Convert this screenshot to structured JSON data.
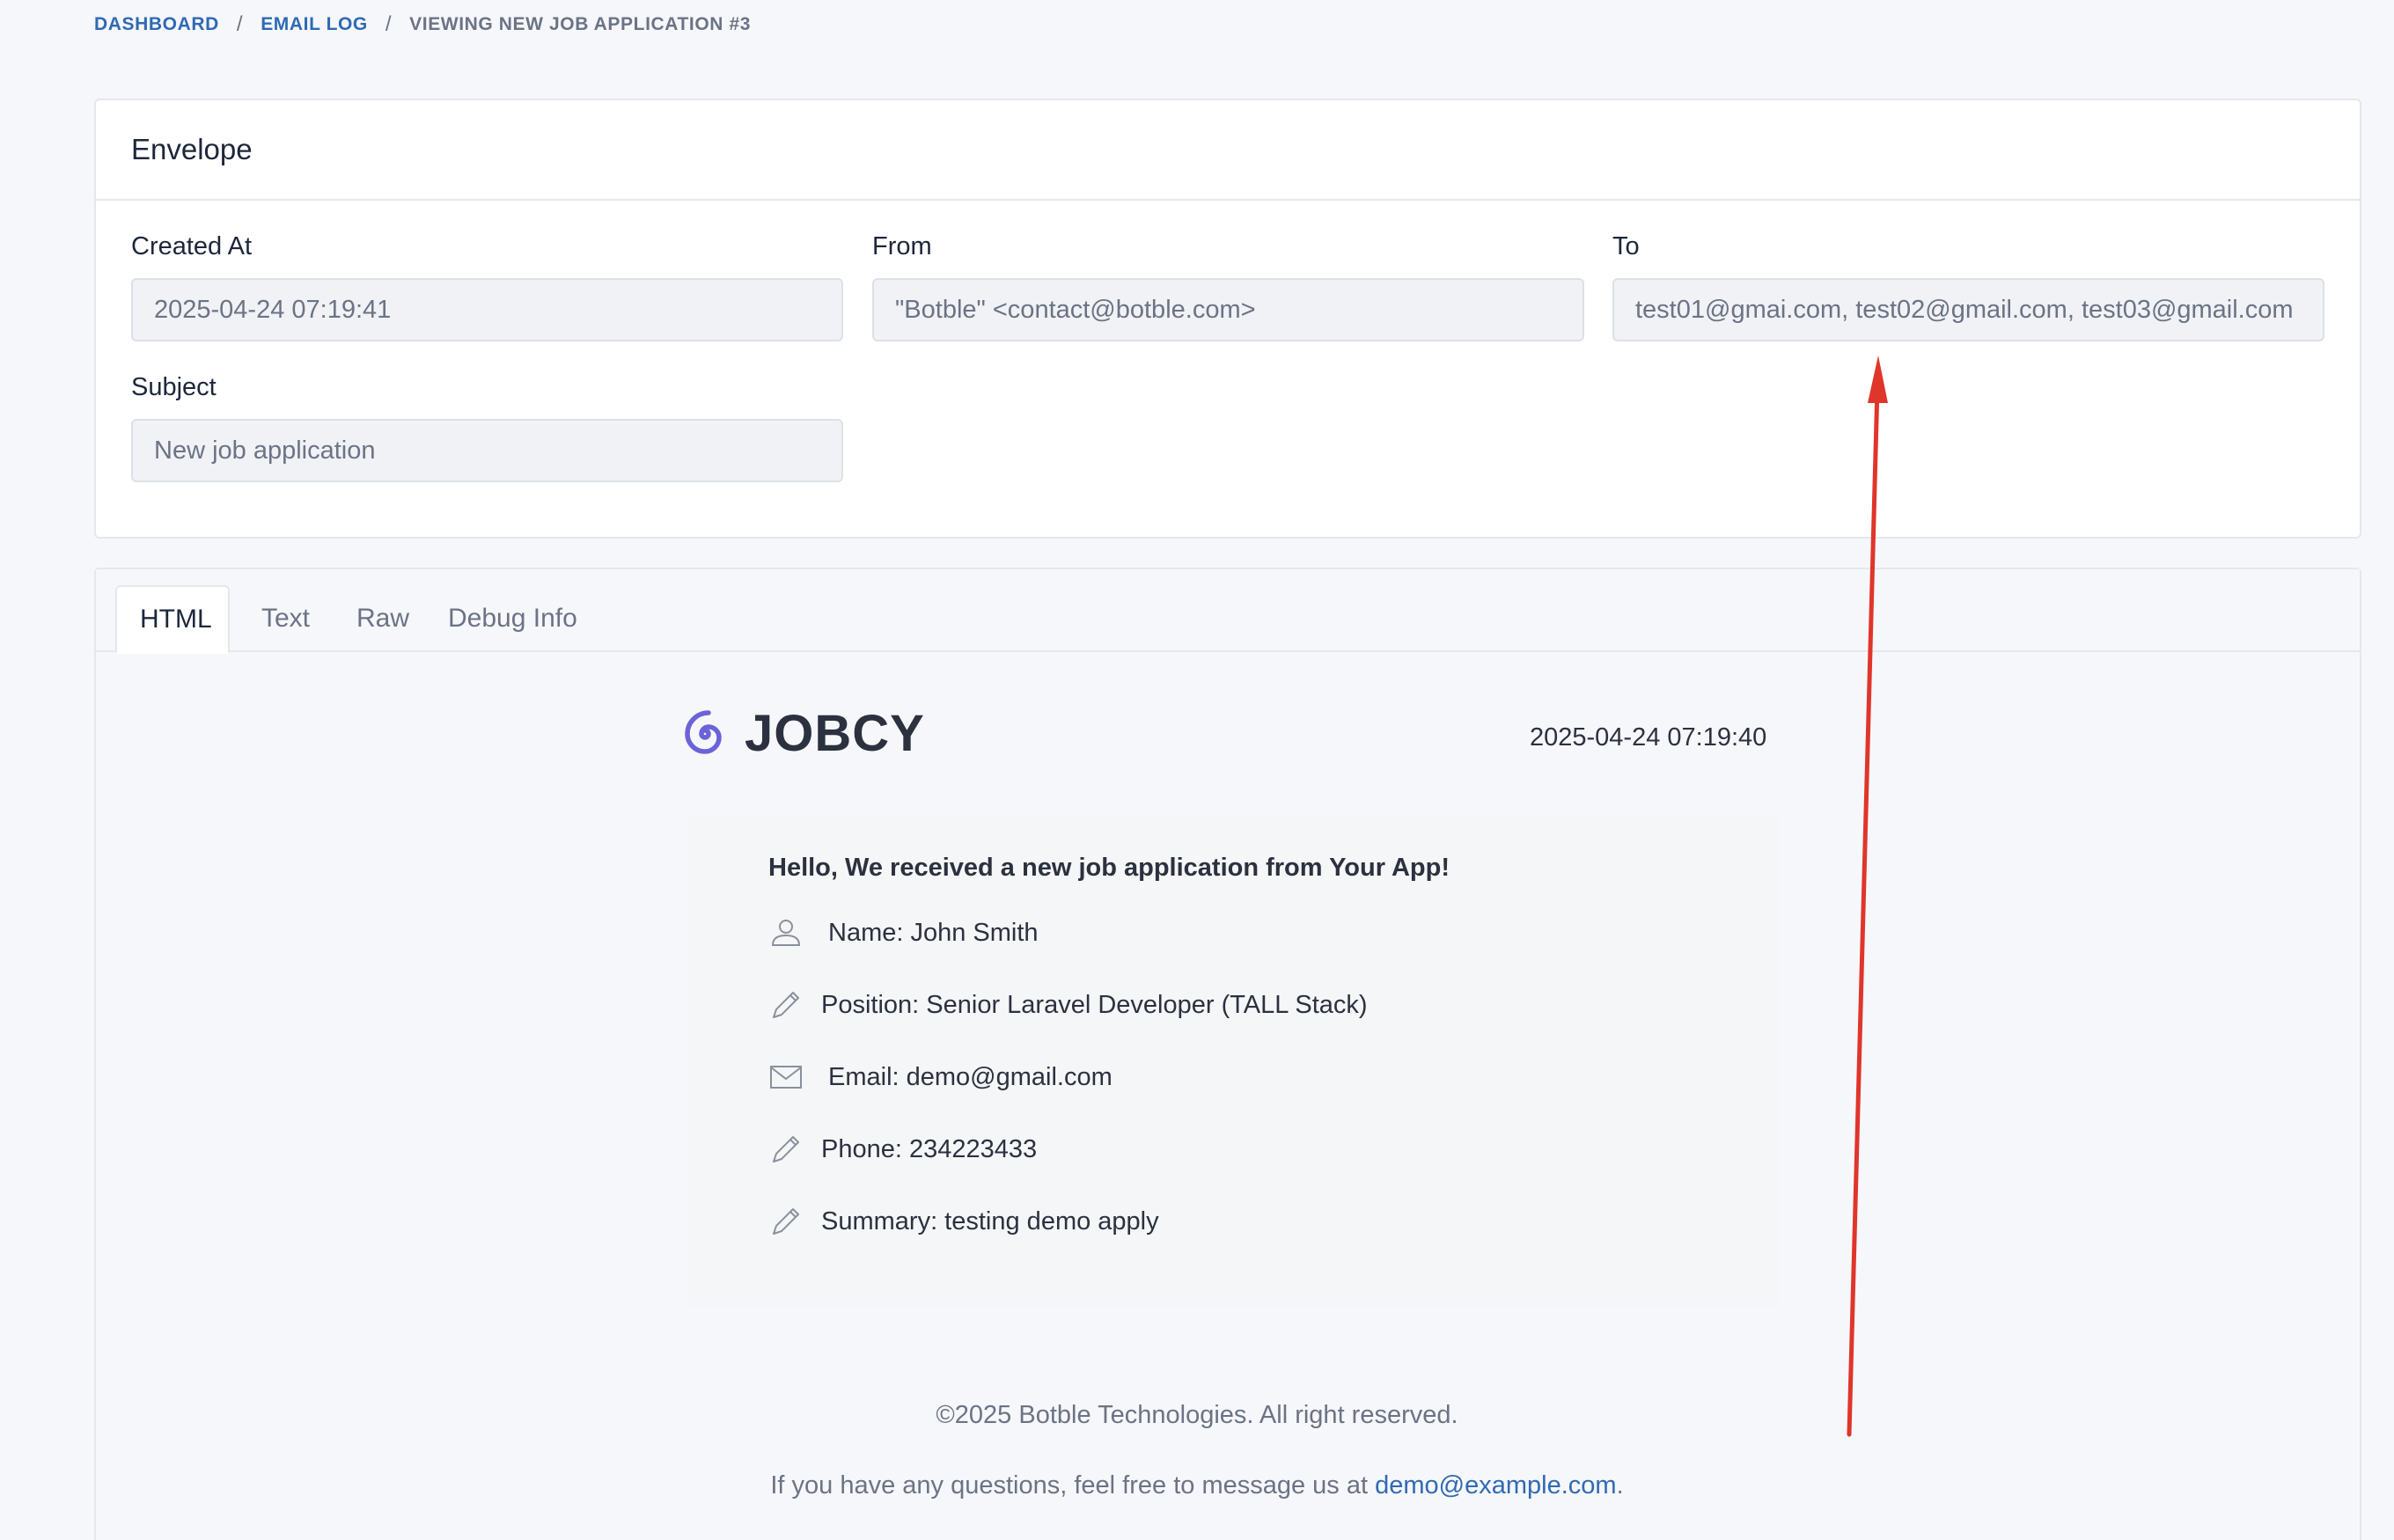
{
  "breadcrumb": {
    "items": [
      {
        "label": "DASHBOARD"
      },
      {
        "label": "EMAIL LOG"
      }
    ],
    "separator": "/",
    "current": "VIEWING NEW JOB APPLICATION #3"
  },
  "envelope": {
    "title": "Envelope",
    "created_at": {
      "label": "Created At",
      "value": "2025-04-24 07:19:41"
    },
    "from": {
      "label": "From",
      "value": "\"Botble\" <contact@botble.com>"
    },
    "to": {
      "label": "To",
      "value": "test01@gmai.com, test02@gmail.com, test03@gmail.com"
    },
    "subject": {
      "label": "Subject",
      "value": "New job application"
    }
  },
  "tabs": [
    {
      "label": "HTML",
      "active": true
    },
    {
      "label": "Text",
      "active": false
    },
    {
      "label": "Raw",
      "active": false
    },
    {
      "label": "Debug Info",
      "active": false
    }
  ],
  "email": {
    "logo_text": "JOBCY",
    "date": "2025-04-24 07:19:40",
    "greeting": "Hello, We received a new job application from Your App!",
    "rows": [
      {
        "icon": "user-icon",
        "text": "Name: John Smith"
      },
      {
        "icon": "pencil-icon",
        "text": "Position: Senior Laravel Developer (TALL Stack)"
      },
      {
        "icon": "envelope-icon",
        "text": "Email: demo@gmail.com"
      },
      {
        "icon": "pencil-icon",
        "text": "Phone: 234223433"
      },
      {
        "icon": "pencil-icon",
        "text": "Summary: testing demo apply"
      }
    ],
    "copyright": "©2025 Botble Technologies. All right reserved.",
    "contact_prefix": "If you have any questions, feel free to message us at",
    "contact_email": "demo@example.com",
    "contact_suffix": "."
  },
  "colors": {
    "link": "#2f6ab4",
    "logo_accent": "#6c63d9",
    "annotation_arrow": "#e0352b"
  }
}
